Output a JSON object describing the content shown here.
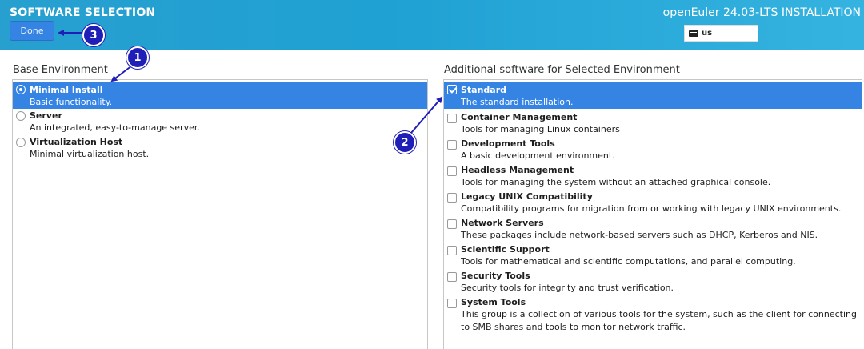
{
  "header": {
    "title": "SOFTWARE SELECTION",
    "product": "openEuler 24.03-LTS INSTALLATION",
    "done_label": "Done",
    "keyboard_layout": "us"
  },
  "base_environment": {
    "label": "Base Environment",
    "items": [
      {
        "name": "Minimal Install",
        "desc": "Basic functionality.",
        "selected": true
      },
      {
        "name": "Server",
        "desc": "An integrated, easy-to-manage server.",
        "selected": false
      },
      {
        "name": "Virtualization Host",
        "desc": "Minimal virtualization host.",
        "selected": false
      }
    ]
  },
  "additional_software": {
    "label": "Additional software for Selected Environment",
    "items": [
      {
        "name": "Standard",
        "desc": "The standard installation.",
        "checked": true
      },
      {
        "name": "Container Management",
        "desc": "Tools for managing Linux containers",
        "checked": false
      },
      {
        "name": "Development Tools",
        "desc": "A basic development environment.",
        "checked": false
      },
      {
        "name": "Headless Management",
        "desc": "Tools for managing the system without an attached graphical console.",
        "checked": false
      },
      {
        "name": "Legacy UNIX Compatibility",
        "desc": "Compatibility programs for migration from or working with legacy UNIX environments.",
        "checked": false
      },
      {
        "name": "Network Servers",
        "desc": "These packages include network-based servers such as DHCP, Kerberos and NIS.",
        "checked": false
      },
      {
        "name": "Scientific Support",
        "desc": "Tools for mathematical and scientific computations, and parallel computing.",
        "checked": false
      },
      {
        "name": "Security Tools",
        "desc": "Security tools for integrity and trust verification.",
        "checked": false
      },
      {
        "name": "System Tools",
        "desc": "This group is a collection of various tools for the system, such as the client for connecting to SMB shares and tools to monitor network traffic.",
        "checked": false
      }
    ]
  },
  "callouts": [
    "1",
    "2",
    "3"
  ],
  "colors": {
    "header": "#27a0cf",
    "selection": "#3584e4",
    "callout": "#1f1fb8"
  }
}
